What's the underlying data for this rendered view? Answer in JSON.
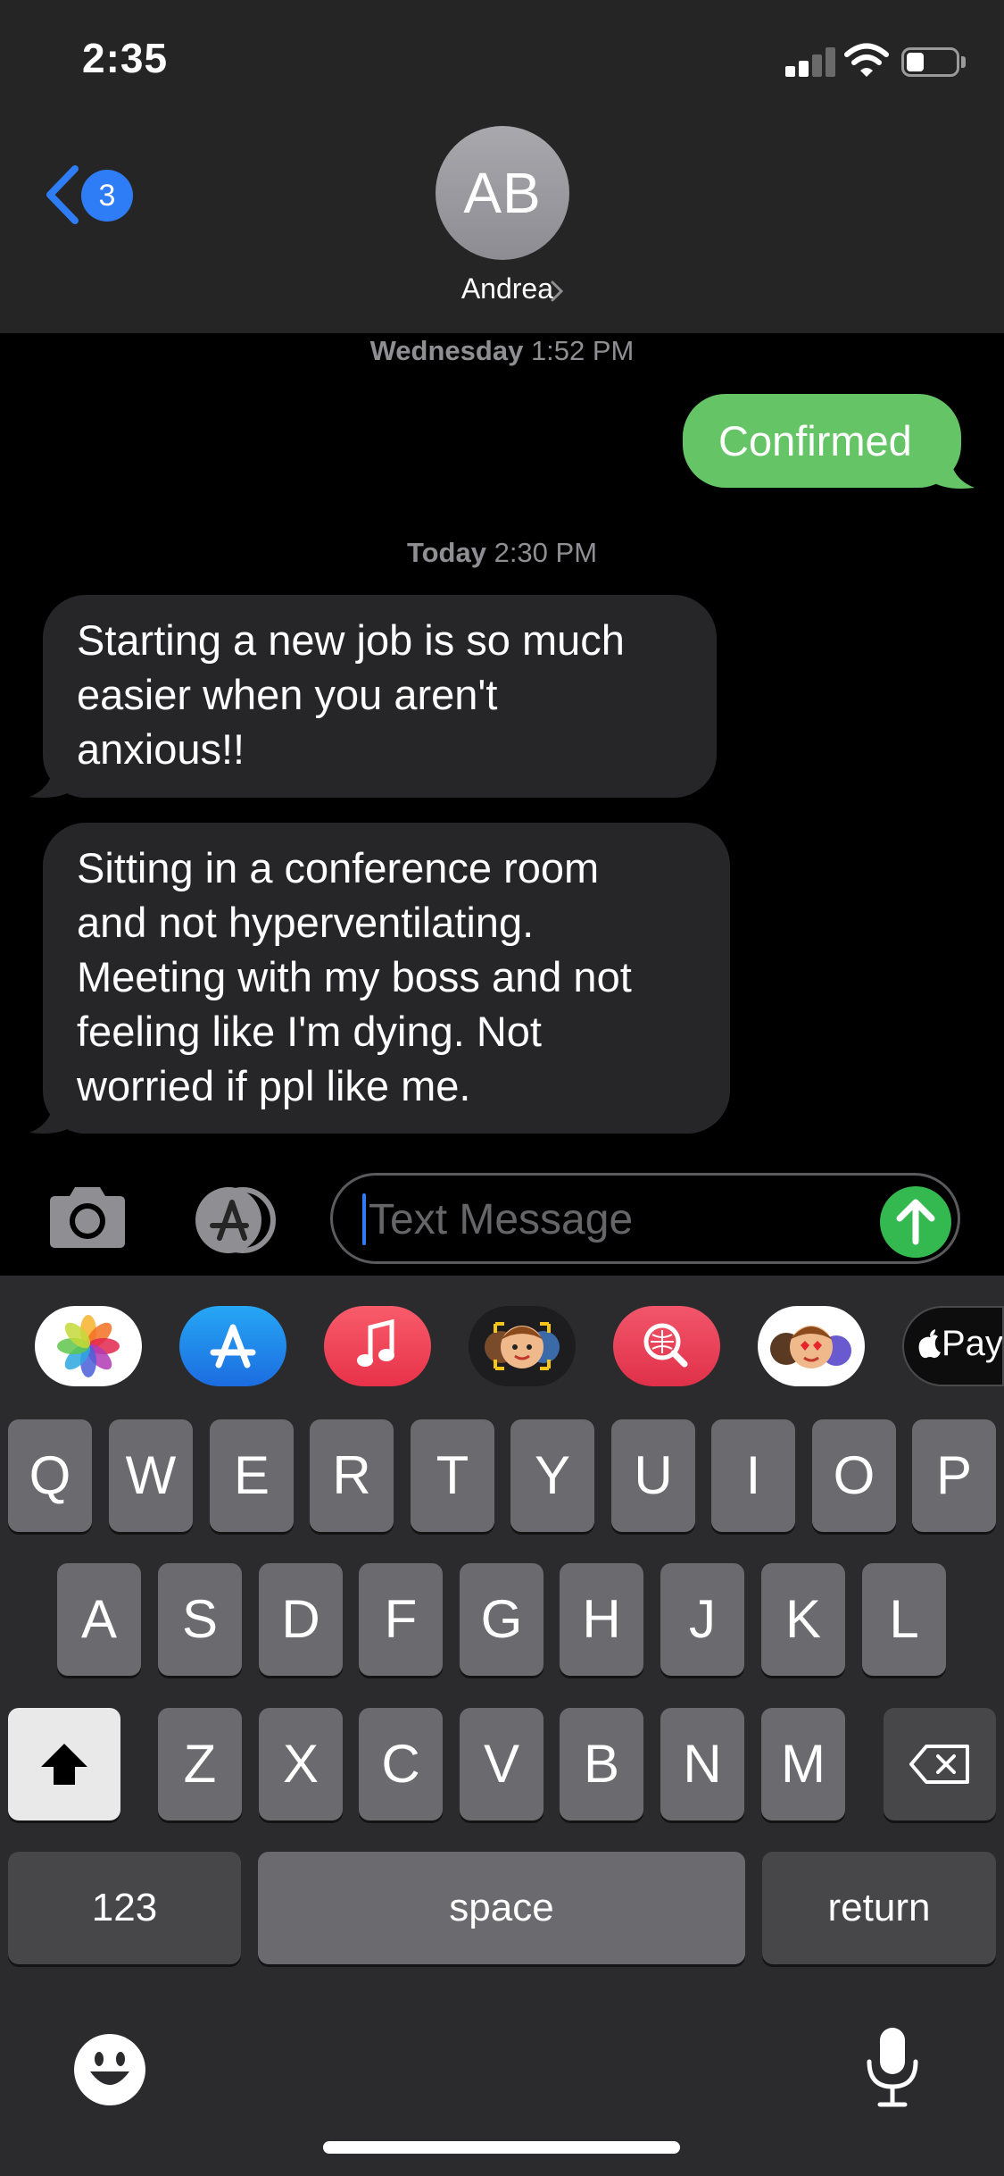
{
  "status_bar": {
    "time": "2:35",
    "battery_level": 0.35
  },
  "header": {
    "back_badge": "3",
    "avatar_initials": "AB",
    "contact_name": "Andrea",
    "contact_chevron": "›"
  },
  "thread": {
    "timestamp_1": {
      "day": "Wednesday",
      "time": "1:52 PM"
    },
    "sent_message": "Confirmed",
    "timestamp_2": {
      "day": "Today",
      "time": "2:30 PM"
    },
    "received_messages": [
      {
        "lines": [
          "Starting a new job is so much",
          "easier when you aren't",
          "anxious!!"
        ]
      },
      {
        "lines": [
          "Sitting in a conference room",
          "and not hyperventilating.",
          "Meeting with my boss and not",
          "feeling like I'm dying. Not",
          "worried if ppl like me."
        ]
      }
    ]
  },
  "input_bar": {
    "placeholder": "Text Message"
  },
  "app_strip": {
    "items": [
      "photos-app",
      "app-store-app",
      "music-app",
      "memoji-app",
      "images-search-app",
      "memoji-stickers-app",
      "apple-pay-app"
    ],
    "apple_pay_label": "Pay"
  },
  "keyboard": {
    "row1": [
      "Q",
      "W",
      "E",
      "R",
      "T",
      "Y",
      "U",
      "I",
      "O",
      "P"
    ],
    "row2": [
      "A",
      "S",
      "D",
      "F",
      "G",
      "H",
      "J",
      "K",
      "L"
    ],
    "row3": [
      "Z",
      "X",
      "C",
      "V",
      "B",
      "N",
      "M"
    ],
    "numbers_label": "123",
    "space_label": "space",
    "return_label": "return"
  },
  "colors": {
    "sent_bubble": "#65c466",
    "received_bubble": "#262628",
    "accent_blue": "#2f7df6",
    "send_button": "#34b850"
  }
}
